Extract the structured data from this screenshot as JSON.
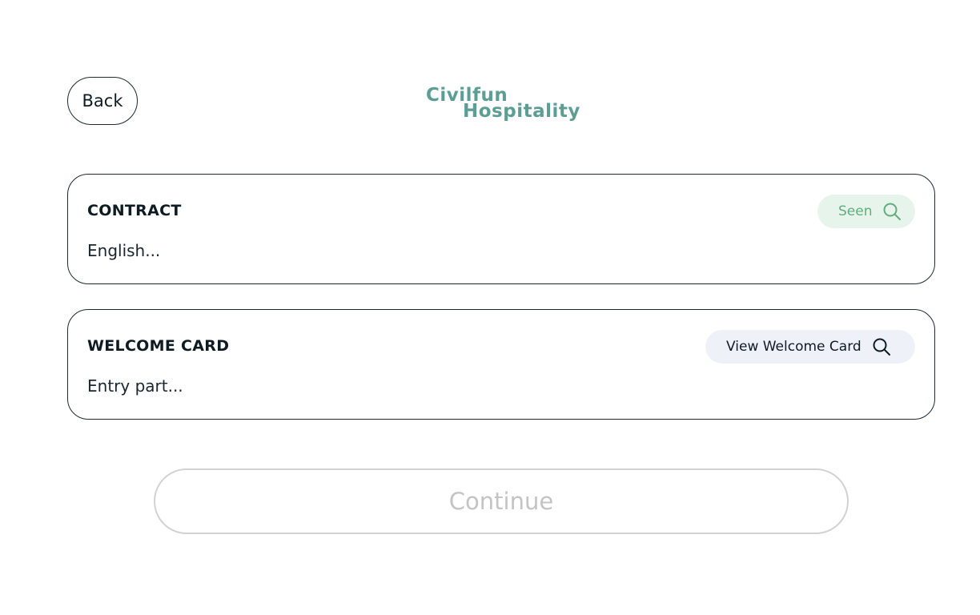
{
  "header": {
    "back_label": "Back",
    "logo_line1": "Civilfun",
    "logo_line2": "Hospitality"
  },
  "cards": [
    {
      "title": "CONTRACT",
      "description": "English...",
      "action_label": "Seen",
      "action_icon": "search-icon",
      "action_state": "seen",
      "action_color": "#5fae7c",
      "action_bg": "#e7f4ec"
    },
    {
      "title": "WELCOME CARD",
      "description": "Entry part...",
      "action_label": "View Welcome Card",
      "action_icon": "search-icon",
      "action_state": "unviewed",
      "action_color": "#0f1b22",
      "action_bg": "#eef2f8"
    }
  ],
  "footer": {
    "continue_label": "Continue",
    "continue_enabled": false
  },
  "colors": {
    "brand": "#5c9e93",
    "border": "#1c2a31",
    "disabled": "#c4c4c4"
  }
}
